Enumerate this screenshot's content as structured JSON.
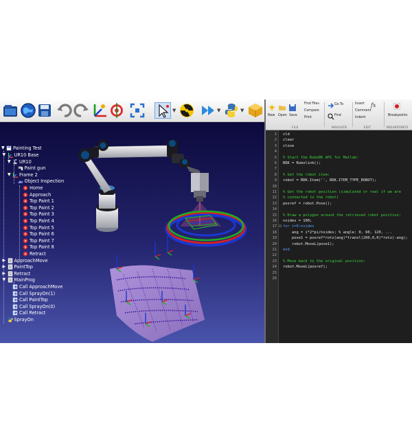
{
  "toolbar": {
    "icons": [
      "open-icon",
      "globe-icon",
      "save-icon",
      "undo-icon",
      "redo-icon",
      "add-reference-icon",
      "target-icon",
      "fit-view-icon",
      "select-pointer-icon",
      "radiation-icon",
      "fast-forward-icon",
      "python-icon",
      "package-icon"
    ]
  },
  "tree": {
    "root": "Painting Test",
    "items": [
      {
        "id": "ur10-base",
        "label": "UR10 Base",
        "icon": "frame-icon"
      },
      {
        "id": "ur10",
        "label": "UR10",
        "icon": "robot-icon"
      },
      {
        "id": "paint-gun",
        "label": "Paint gun",
        "icon": "tool-icon"
      },
      {
        "id": "frame-2",
        "label": "Frame 2",
        "icon": "frame-icon"
      },
      {
        "id": "object-inspection",
        "label": "Object Inspection",
        "icon": "object-icon"
      },
      {
        "id": "home",
        "label": "Home",
        "icon": "target-icon"
      },
      {
        "id": "approach",
        "label": "Approach",
        "icon": "target-icon"
      },
      {
        "id": "top-paint-1",
        "label": "Top Paint 1",
        "icon": "target-icon"
      },
      {
        "id": "top-paint-2",
        "label": "Top Paint 2",
        "icon": "target-icon"
      },
      {
        "id": "top-paint-3",
        "label": "Top Paint 3",
        "icon": "target-icon"
      },
      {
        "id": "top-paint-4",
        "label": "Top Paint 4",
        "icon": "target-icon"
      },
      {
        "id": "top-paint-5",
        "label": "Top Paint 5",
        "icon": "target-icon"
      },
      {
        "id": "top-paint-6",
        "label": "Top Paint 6",
        "icon": "target-icon"
      },
      {
        "id": "top-paint-7",
        "label": "Top Paint 7",
        "icon": "target-icon"
      },
      {
        "id": "top-paint-8",
        "label": "Top Paint 8",
        "icon": "target-icon"
      },
      {
        "id": "retract-target",
        "label": "Retract",
        "icon": "target-icon"
      },
      {
        "id": "approachmove",
        "label": "ApproachMove",
        "icon": "program-icon"
      },
      {
        "id": "painttop",
        "label": "PaintTop",
        "icon": "program-icon"
      },
      {
        "id": "retract-prog",
        "label": "Retract",
        "icon": "program-icon"
      },
      {
        "id": "mainprog",
        "label": "MainProg",
        "icon": "program-icon"
      },
      {
        "id": "call-approachmove",
        "label": "Call ApproachMove",
        "icon": "call-icon"
      },
      {
        "id": "call-sprayon-1",
        "label": "Call SprayOn(1)",
        "icon": "call-icon"
      },
      {
        "id": "call-painttop",
        "label": "Call PaintTop",
        "icon": "call-icon"
      },
      {
        "id": "call-sprayon-0",
        "label": "Call SprayOn(0)",
        "icon": "call-icon"
      },
      {
        "id": "call-retract",
        "label": "Call Retract",
        "icon": "call-icon"
      },
      {
        "id": "sprayon",
        "label": "SprayOn",
        "icon": "script-icon"
      }
    ]
  },
  "ribbon": {
    "buttons": {
      "new": "New",
      "open": "Open",
      "save": "Save",
      "find_files": "Find Files",
      "compare": "Compare",
      "print": "Print",
      "go_to": "Go To",
      "find": "Find",
      "insert": "Insert",
      "comment": "Comment",
      "indent": "Indent",
      "breakpoints": "Breakpoints"
    },
    "sections": {
      "file": "FILE",
      "navigate": "NAVIGATE",
      "edit": "EDIT",
      "breakpoints": "BREAKPOINTS"
    }
  },
  "editor": {
    "line_numbers": [
      "1",
      "2",
      "3",
      "4",
      "5",
      "6",
      "7",
      "8",
      "9",
      "10",
      "11",
      "12",
      "13",
      "14",
      "15",
      "16",
      "17",
      "18",
      "19",
      "20",
      "21",
      "22",
      "23",
      "24",
      "25",
      "26"
    ],
    "lines": [
      {
        "t": "cld",
        "k": "plain"
      },
      {
        "t": "clear",
        "k": "plain"
      },
      {
        "t": "close",
        "k": "plain"
      },
      {
        "t": "",
        "k": "plain"
      },
      {
        "t": "% Start the RoboDK API for Matlab:",
        "k": "comment"
      },
      {
        "t": "RDK = Robolink();",
        "k": "plain"
      },
      {
        "t": "",
        "k": "plain"
      },
      {
        "t": "% Get the robot item:",
        "k": "comment"
      },
      {
        "t": "robot = RDK.Item('', RDK.ITEM_TYPE_ROBOT);",
        "k": "plain"
      },
      {
        "t": "",
        "k": "plain"
      },
      {
        "t": "% Get the robot position (simulated or real if we are",
        "k": "comment"
      },
      {
        "t": "% connected to the robot)",
        "k": "comment"
      },
      {
        "t": "posref = robot.Pose();",
        "k": "plain"
      },
      {
        "t": "",
        "k": "plain"
      },
      {
        "t": "% Draw a polygon around the retrieved robot position:",
        "k": "comment"
      },
      {
        "t": "nsides = 100;",
        "k": "plain"
      },
      {
        "t": "for i=0:nsides",
        "k": "kw"
      },
      {
        "t": "    ang = i*2*pi/nsides; % angle: 0, 60, 120, ...",
        "k": "plain"
      },
      {
        "t": "    pose1 = posref*rotz(ang)*transl(200,0,0)*rotz(-ang);",
        "k": "plain"
      },
      {
        "t": "    robot.MoveL(pose1);",
        "k": "plain"
      },
      {
        "t": "end",
        "k": "kw"
      },
      {
        "t": "",
        "k": "plain"
      },
      {
        "t": "% Move back to the original position:",
        "k": "comment"
      },
      {
        "t": "robot.MoveL(posref);",
        "k": "plain"
      },
      {
        "t": "",
        "k": "plain"
      },
      {
        "t": "",
        "k": "plain"
      }
    ]
  },
  "colors": {
    "viewport_top": "#0c0a3c",
    "viewport_bottom": "#4a54ac",
    "editor_bg": "#1e1e1e",
    "comment": "#3cd43c"
  }
}
